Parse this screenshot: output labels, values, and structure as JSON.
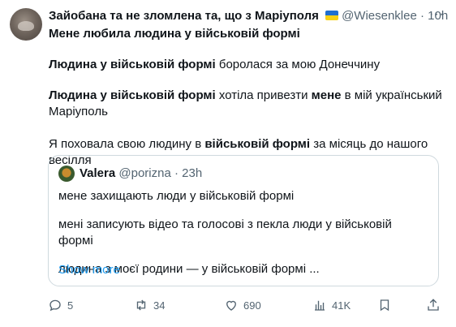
{
  "author": {
    "name": "Зайобана та не зломлена та, що з Маріуполя",
    "handle": "@Wiesenklee",
    "separator": "·",
    "time": "10h"
  },
  "tweet": {
    "line1": "Мене любила людина у військовій формі",
    "line2_bold": "Людина у військовій формі",
    "line2_rest": " боролася за мою Донеччину",
    "line3_bold": "Людина у військовій формі",
    "line3_mid": " хотіла привезти ",
    "line3_bold2": "мене",
    "line3_rest": " в мій український Маріуполь",
    "line4_start": "Я поховала свою людину в ",
    "line4_bold": "військовій формі",
    "line4_rest": " за місяць до нашого весілля"
  },
  "quote": {
    "name": "Valera",
    "handle": "@porizna",
    "separator": "·",
    "time": "23h",
    "line1": "мене захищають люди у військовій формі",
    "line2": "мені записують відео та голосові з пекла люди у військовій формі",
    "line3": "людина з моєї родини — у військовій формі ...",
    "show_more": "Show more"
  },
  "actions": {
    "replies": "5",
    "reposts": "34",
    "likes": "690",
    "views": "41K"
  }
}
